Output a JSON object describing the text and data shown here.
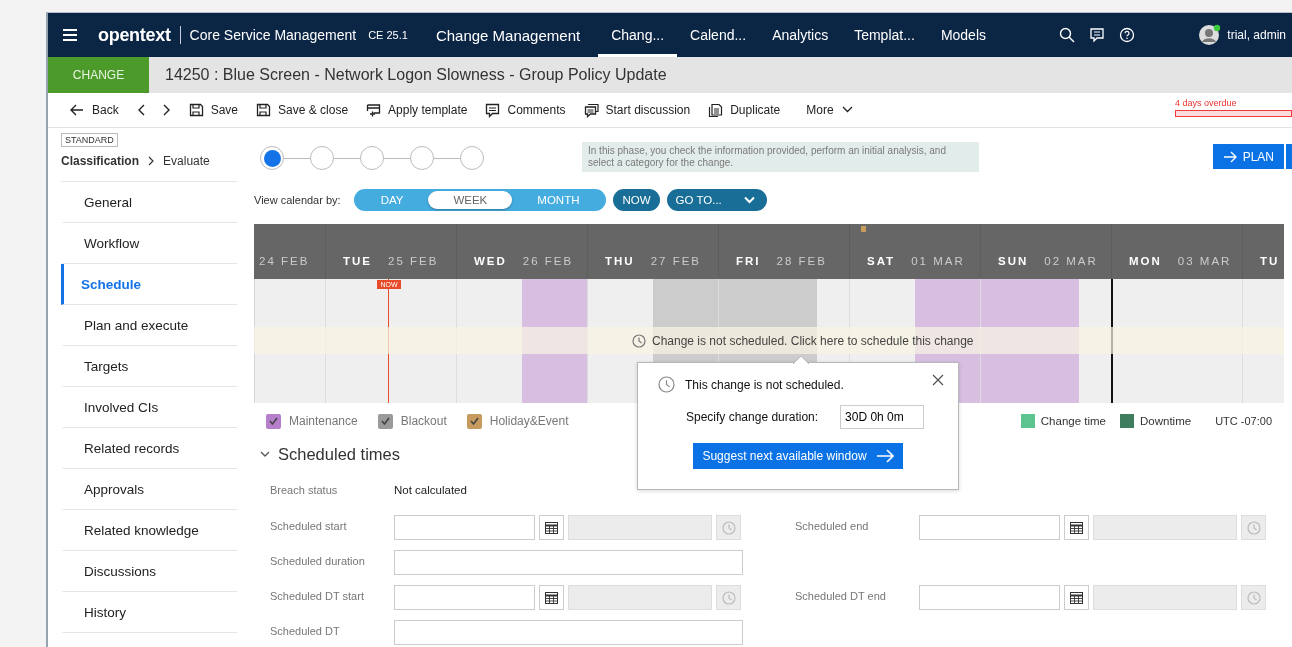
{
  "navbar": {
    "brand": "opentext",
    "product": "Core Service Management",
    "version": "CE 25.1",
    "module": "Change Management",
    "tabs": [
      {
        "label": "Chang...",
        "selected": true
      },
      {
        "label": "Calend...",
        "selected": false
      },
      {
        "label": "Analytics",
        "selected": false
      },
      {
        "label": "Templat...",
        "selected": false
      },
      {
        "label": "Models",
        "selected": false
      }
    ],
    "user": "trial, admin"
  },
  "record": {
    "type": "CHANGE",
    "title": "14250 : Blue Screen - Network Logon Slowness - Group Policy Update"
  },
  "toolbar": {
    "items": [
      {
        "kind": "back",
        "label": "Back"
      },
      {
        "kind": "prev"
      },
      {
        "kind": "next"
      },
      {
        "kind": "save",
        "label": "Save"
      },
      {
        "kind": "save_close",
        "label": "Save & close"
      },
      {
        "kind": "template",
        "label": "Apply template"
      },
      {
        "kind": "comments",
        "label": "Comments"
      },
      {
        "kind": "discussion",
        "label": "Start discussion"
      },
      {
        "kind": "duplicate",
        "label": "Duplicate"
      },
      {
        "kind": "more",
        "label": "More"
      }
    ],
    "overdue": "4 days overdue"
  },
  "sidebar": {
    "badge": "STANDARD",
    "phase": "Classification",
    "step": "Evaluate",
    "items": [
      {
        "label": "General",
        "selected": false
      },
      {
        "label": "Workflow",
        "selected": false
      },
      {
        "label": "Schedule",
        "selected": true
      },
      {
        "label": "Plan and execute",
        "selected": false
      },
      {
        "label": "Targets",
        "selected": false
      },
      {
        "label": "Involved CIs",
        "selected": false
      },
      {
        "label": "Related records",
        "selected": false
      },
      {
        "label": "Approvals",
        "selected": false
      },
      {
        "label": "Related knowledge",
        "selected": false
      },
      {
        "label": "Discussions",
        "selected": false
      },
      {
        "label": "History",
        "selected": false
      }
    ]
  },
  "phases": {
    "steps": [
      {
        "selected": true
      },
      {
        "selected": false
      },
      {
        "selected": false
      },
      {
        "selected": false
      },
      {
        "selected": false
      }
    ],
    "hint": "In this phase, you check the information provided, perform an initial analysis, and select a category for the change.",
    "next_button": "PLAN"
  },
  "calendar": {
    "view_label": "View calendar by:",
    "views": [
      {
        "label": "DAY",
        "selected": false
      },
      {
        "label": "WEEK",
        "selected": true
      },
      {
        "label": "MONTH",
        "selected": false
      }
    ],
    "now_button": "NOW",
    "goto_button": "GO TO...",
    "days": [
      {
        "date": "24 FEB",
        "quarters": [
          {
            "kind": "free"
          },
          {
            "kind": "free"
          },
          {
            "kind": "free"
          },
          {
            "kind": "free"
          }
        ],
        "now": false,
        "holiday": false,
        "week_start": false
      },
      {
        "weekday": "TUE",
        "date": "25 FEB",
        "quarters": [
          {
            "kind": "free"
          },
          {
            "kind": "free"
          },
          {
            "kind": "free"
          },
          {
            "kind": "free"
          }
        ],
        "now": true,
        "holiday": false,
        "week_start": false
      },
      {
        "weekday": "WED",
        "date": "26 FEB",
        "quarters": [
          {
            "kind": "free"
          },
          {
            "kind": "free"
          },
          {
            "kind": "maintenance"
          },
          {
            "kind": "maintenance"
          }
        ],
        "now": false,
        "holiday": false,
        "week_start": false
      },
      {
        "weekday": "THU",
        "date": "27 FEB",
        "quarters": [
          {
            "kind": "free"
          },
          {
            "kind": "free"
          },
          {
            "kind": "blackout"
          },
          {
            "kind": "blackout"
          }
        ],
        "now": false,
        "holiday": false,
        "week_start": false
      },
      {
        "weekday": "FRI",
        "date": "28 FEB",
        "quarters": [
          {
            "kind": "blackout"
          },
          {
            "kind": "blackout"
          },
          {
            "kind": "blackout"
          },
          {
            "kind": "free"
          }
        ],
        "now": false,
        "holiday": false,
        "week_start": false
      },
      {
        "weekday": "SAT",
        "date": "01 MAR",
        "quarters": [
          {
            "kind": "free"
          },
          {
            "kind": "free"
          },
          {
            "kind": "maintenance"
          },
          {
            "kind": "maintenance"
          }
        ],
        "now": false,
        "holiday": true,
        "week_start": false
      },
      {
        "weekday": "SUN",
        "date": "02 MAR",
        "quarters": [
          {
            "kind": "maintenance"
          },
          {
            "kind": "maintenance"
          },
          {
            "kind": "maintenance"
          },
          {
            "kind": "free"
          }
        ],
        "now": false,
        "holiday": false,
        "week_start": false
      },
      {
        "weekday": "MON",
        "date": "03 MAR",
        "quarters": [
          {
            "kind": "free"
          },
          {
            "kind": "free"
          },
          {
            "kind": "free"
          },
          {
            "kind": "free"
          }
        ],
        "now": false,
        "holiday": false,
        "week_start": true
      },
      {
        "weekday": "TU",
        "quarters": [
          {
            "kind": "free"
          },
          {
            "kind": "free"
          },
          {
            "kind": "free"
          },
          {
            "kind": "free"
          }
        ],
        "now": false,
        "holiday": false,
        "week_start": false
      }
    ],
    "now_label": "NOW",
    "message": "Change is not scheduled. Click here to schedule this change",
    "legend": [
      {
        "kind": "maintenance",
        "label": "Maintenance",
        "color": "#b57fcc",
        "checked": true
      },
      {
        "kind": "blackout",
        "label": "Blackout",
        "color": "#9a9a9a",
        "checked": true
      },
      {
        "kind": "holiday",
        "label": "Holiday&Event",
        "color": "#c79a5e",
        "checked": true
      }
    ],
    "time_legend": [
      {
        "label": "Change time",
        "color": "#5cc58f"
      },
      {
        "label": "Downtime",
        "color": "#3e7d5e"
      }
    ],
    "timezone": "UTC -07:00"
  },
  "popup": {
    "message": "This change is not scheduled.",
    "duration_label": "Specify change duration:",
    "duration_value": "30D 0h 0m",
    "suggest_button": "Suggest next available window"
  },
  "scheduled_times": {
    "title": "Scheduled times",
    "expanded": true,
    "breach_label": "Breach status",
    "breach_value": "Not calculated",
    "fields": [
      {
        "kind": "datetime",
        "label": "Scheduled start"
      },
      {
        "kind": "datetime",
        "label": "Scheduled end"
      },
      {
        "kind": "text",
        "label": "Scheduled duration"
      },
      {
        "kind": "datetime",
        "label": "Scheduled DT start"
      },
      {
        "kind": "datetime",
        "label": "Scheduled DT end"
      },
      {
        "kind": "text",
        "label": "Scheduled DT"
      }
    ]
  }
}
